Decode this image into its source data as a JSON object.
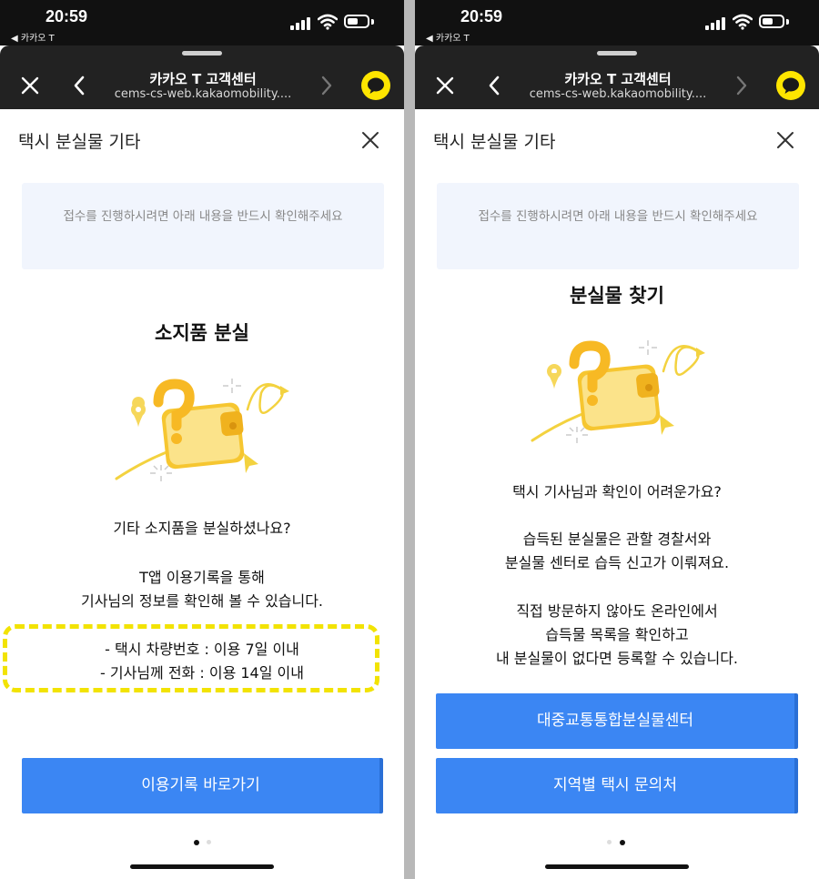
{
  "status_bar": {
    "time": "20:59",
    "back_app": "◀ 카카오 T"
  },
  "browser": {
    "title": "카카오 T 고객센터",
    "url": "cems-cs-web.kakaomobility...."
  },
  "sheet_title": "택시 분실물 기타",
  "notice": "접수를 진행하시려면 아래 내용을 반드시 확인해주세요",
  "left": {
    "heading": "소지품 분실",
    "question": "기타 소지품을 분실하셨나요?",
    "info_lines": [
      "T앱 이용기록을 통해",
      "기사님의 정보를 확인해 볼 수 있습니다."
    ],
    "highlight_lines": [
      "- 택시 차량번호 : 이용 7일 이내",
      "- 기사님께 전화 : 이용 14일 이내"
    ],
    "button_label": "이용기록 바로가기",
    "page_index": 1,
    "page_count": 2
  },
  "right": {
    "heading": "분실물 찾기",
    "question": "택시 기사님과 확인이 어려운가요?",
    "para1": [
      "습득된 분실물은 관할 경찰서와",
      "분실물 센터로 습득 신고가 이뤄져요."
    ],
    "para2": [
      "직접 방문하지 않아도 온라인에서",
      "습득물 목록을 확인하고",
      "내 분실물이 없다면 등록할 수 있습니다."
    ],
    "button1_label": "대중교통통합분실물센터",
    "button2_label": "지역별 택시 문의처",
    "page_index": 2,
    "page_count": 2
  },
  "colors": {
    "accent_blue": "#3b86f3",
    "kakao_yellow": "#fee500",
    "highlight_yellow": "#f2e303",
    "notice_bg": "#f1f5fd"
  },
  "icons": [
    "close-icon",
    "back-chevron-icon",
    "forward-chevron-icon",
    "kakaotalk-icon",
    "wallet-question-illustration",
    "signal-icon",
    "wifi-icon",
    "battery-icon"
  ]
}
